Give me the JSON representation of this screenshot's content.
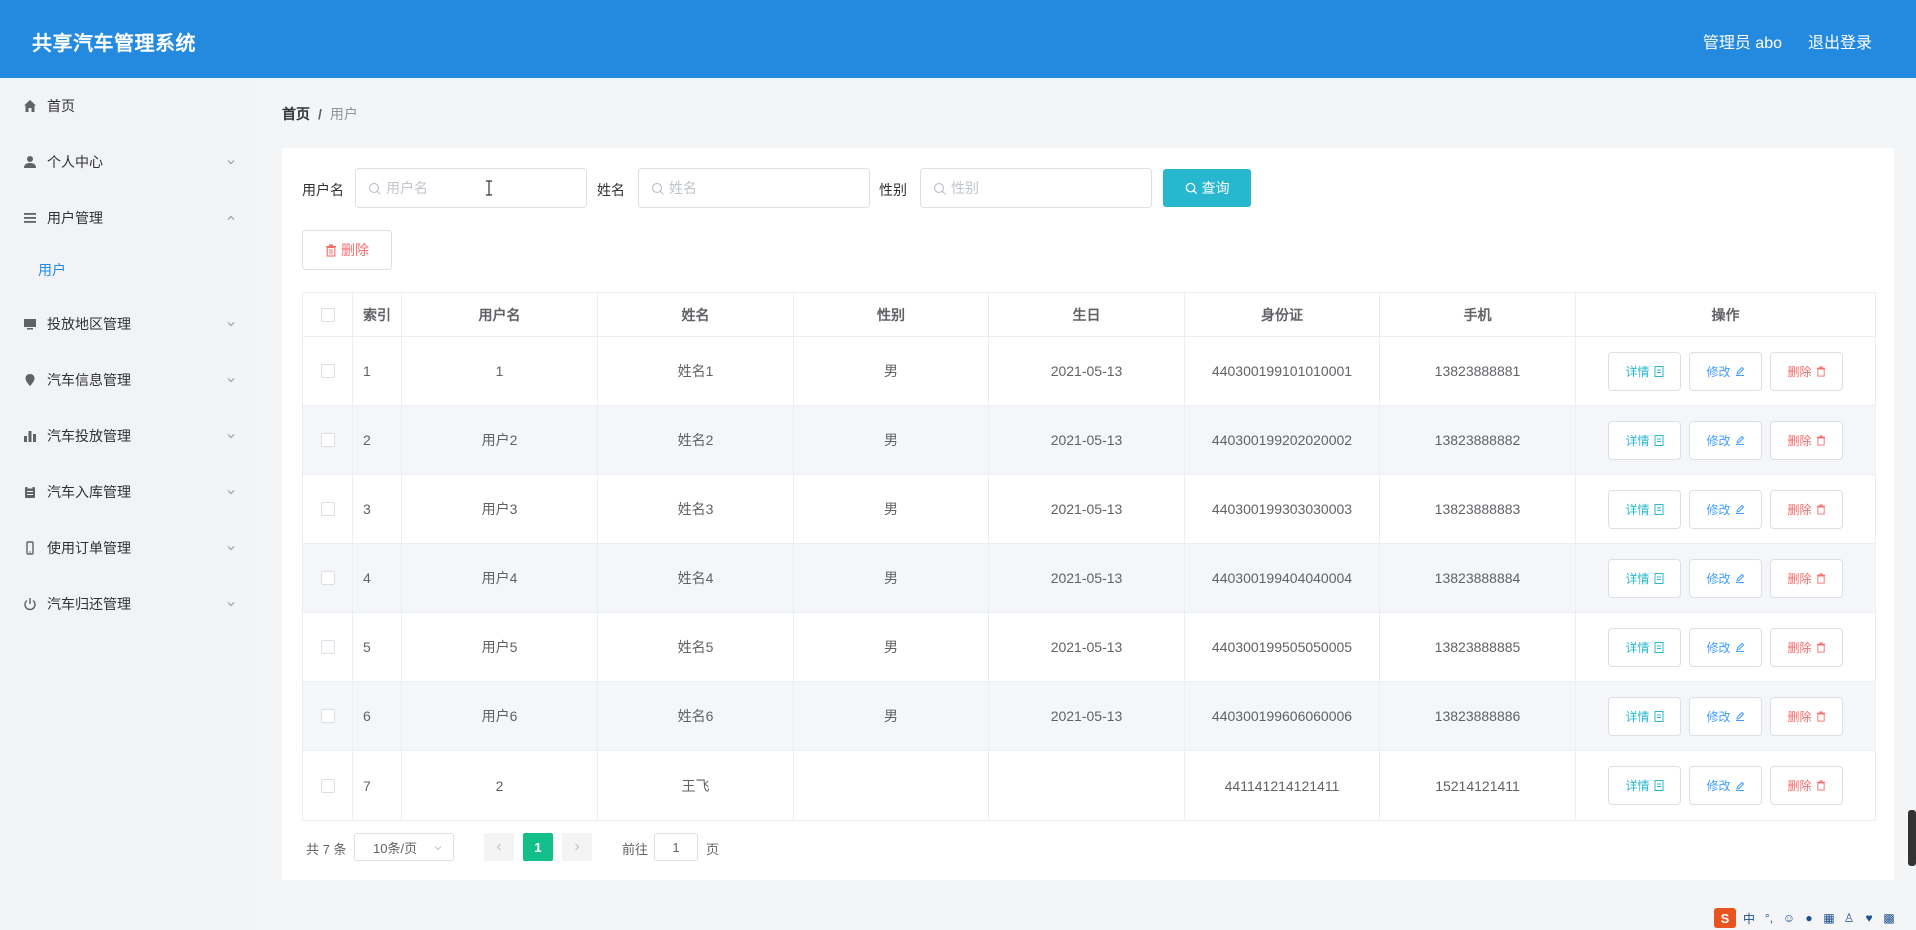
{
  "header": {
    "title": "共享汽车管理系统",
    "user": "管理员 abo",
    "logout": "退出登录"
  },
  "sidebar": {
    "items": [
      {
        "label": "首页",
        "icon": "home-icon"
      },
      {
        "label": "个人中心",
        "icon": "user-icon"
      },
      {
        "label": "用户管理",
        "icon": "list-icon"
      },
      {
        "label": "投放地区管理",
        "icon": "monitor-icon"
      },
      {
        "label": "汽车信息管理",
        "icon": "location-icon"
      },
      {
        "label": "汽车投放管理",
        "icon": "bar-chart-icon"
      },
      {
        "label": "汽车入库管理",
        "icon": "clipboard-icon"
      },
      {
        "label": "使用订单管理",
        "icon": "mobile-icon"
      },
      {
        "label": "汽车归还管理",
        "icon": "power-icon"
      }
    ],
    "sub_item": "用户"
  },
  "breadcrumb": {
    "home": "首页",
    "separator": "/",
    "current": "用户"
  },
  "search": {
    "username_label": "用户名",
    "username_placeholder": "用户名",
    "name_label": "姓名",
    "name_placeholder": "姓名",
    "sex_label": "性别",
    "sex_placeholder": "性别",
    "query_label": "查询"
  },
  "actions": {
    "delete_label": "删除"
  },
  "table": {
    "headers": [
      "索引",
      "用户名",
      "姓名",
      "性别",
      "生日",
      "身份证",
      "手机",
      "操作"
    ],
    "rows": [
      {
        "index": "1",
        "username": "1",
        "name": "姓名1",
        "sex": "男",
        "birthday": "2021-05-13",
        "id_card": "440300199101010001",
        "phone": "13823888881"
      },
      {
        "index": "2",
        "username": "用户2",
        "name": "姓名2",
        "sex": "男",
        "birthday": "2021-05-13",
        "id_card": "440300199202020002",
        "phone": "13823888882"
      },
      {
        "index": "3",
        "username": "用户3",
        "name": "姓名3",
        "sex": "男",
        "birthday": "2021-05-13",
        "id_card": "440300199303030003",
        "phone": "13823888883"
      },
      {
        "index": "4",
        "username": "用户4",
        "name": "姓名4",
        "sex": "男",
        "birthday": "2021-05-13",
        "id_card": "440300199404040004",
        "phone": "13823888884"
      },
      {
        "index": "5",
        "username": "用户5",
        "name": "姓名5",
        "sex": "男",
        "birthday": "2021-05-13",
        "id_card": "440300199505050005",
        "phone": "13823888885"
      },
      {
        "index": "6",
        "username": "用户6",
        "name": "姓名6",
        "sex": "男",
        "birthday": "2021-05-13",
        "id_card": "440300199606060006",
        "phone": "13823888886"
      },
      {
        "index": "7",
        "username": "2",
        "name": "王飞",
        "sex": "",
        "birthday": "",
        "id_card": "441141214121411",
        "phone": "15214121411"
      }
    ],
    "ops": {
      "detail": "详情",
      "edit": "修改",
      "delete": "删除"
    }
  },
  "pagination": {
    "total": "共 7 条",
    "page_size": "10条/页",
    "current_page": "1",
    "goto_label": "前往",
    "goto_value": "1",
    "page_unit": "页"
  },
  "tray": {
    "ime_logo": "S",
    "ime_mode": "中"
  },
  "colors": {
    "header": "#238ae0",
    "query_button": "#27b8d0",
    "active_page": "#13c08a",
    "danger": "#f56c6c"
  }
}
